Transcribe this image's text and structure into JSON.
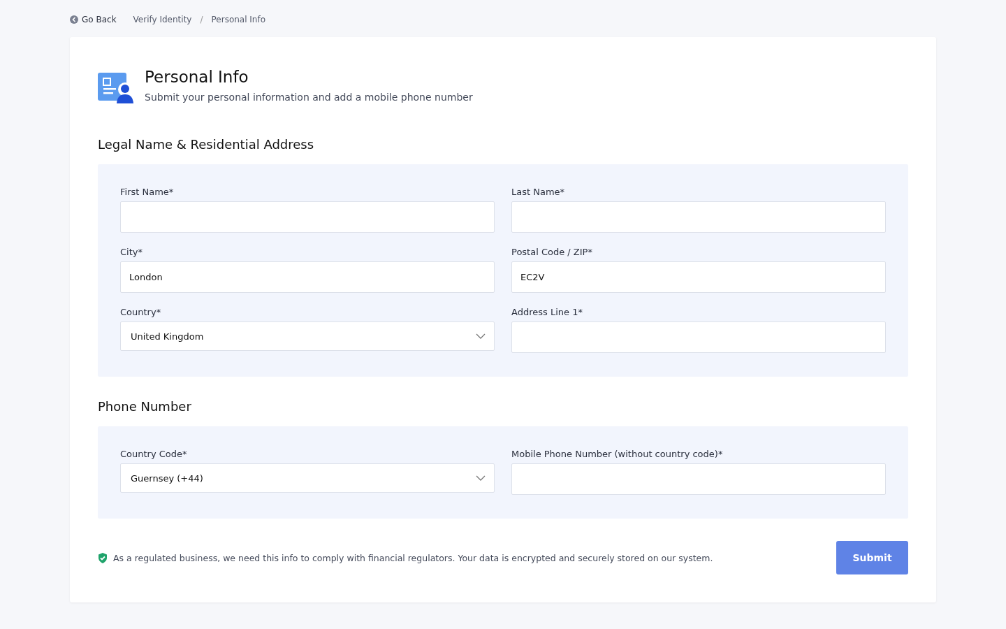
{
  "breadcrumb": {
    "back": "Go Back",
    "items": [
      "Verify Identity",
      "Personal Info"
    ],
    "separator": "/"
  },
  "header": {
    "title": "Personal Info",
    "subtitle": "Submit your personal information and add a mobile phone number"
  },
  "sections": [
    {
      "title": "Legal Name & Residential Address",
      "fields": [
        {
          "kind": "text",
          "label": "First Name*"
        },
        {
          "kind": "text",
          "label": "Last Name*"
        },
        {
          "kind": "text",
          "label": "City*",
          "value": "London"
        },
        {
          "kind": "text",
          "label": "Postal Code / ZIP*",
          "value": "EC2V"
        },
        {
          "kind": "select",
          "label": "Country*",
          "value": "United Kingdom"
        },
        {
          "kind": "text",
          "label": "Address Line 1*"
        }
      ]
    },
    {
      "title": "Phone Number",
      "fields": [
        {
          "kind": "select",
          "label": "Country Code*",
          "value": "Guernsey (+44)"
        },
        {
          "kind": "text",
          "label": "Mobile Phone Number (without country code)*"
        }
      ]
    }
  ],
  "notice": "As a regulated business, we need this info to comply with financial regulators. Your data is encrypted and securely stored on our system.",
  "submit": "Submit"
}
